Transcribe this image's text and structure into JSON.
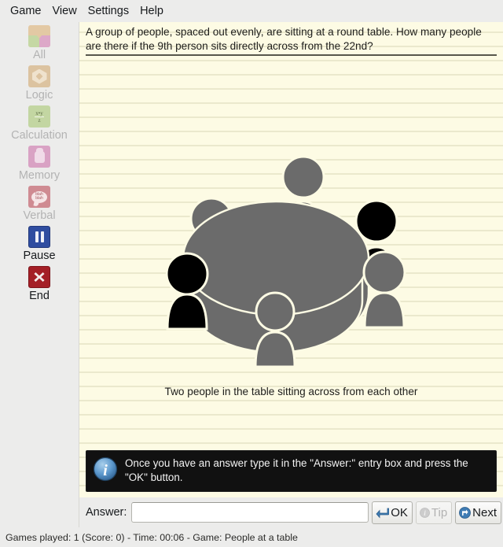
{
  "menubar": {
    "items": [
      {
        "label": "Game",
        "name": "menu-game"
      },
      {
        "label": "View",
        "name": "menu-view"
      },
      {
        "label": "Settings",
        "name": "menu-settings"
      },
      {
        "label": "Help",
        "name": "menu-help"
      }
    ]
  },
  "sidebar": {
    "items": [
      {
        "label": "All",
        "icon": "pie-chart-icon",
        "enabled": false
      },
      {
        "label": "Logic",
        "icon": "gem-icon",
        "enabled": false
      },
      {
        "label": "Calculation",
        "icon": "fraction-icon",
        "enabled": false
      },
      {
        "label": "Memory",
        "icon": "hand-icon",
        "enabled": false
      },
      {
        "label": "Verbal",
        "icon": "speech-bubble-icon",
        "enabled": false
      },
      {
        "label": "Pause",
        "icon": "pause-icon",
        "enabled": true
      },
      {
        "label": "End",
        "icon": "close-x-icon",
        "enabled": true
      }
    ],
    "calc_icon_numerator": "x•y",
    "calc_icon_denominator": "z",
    "verbal_icon_text": "blah blah"
  },
  "game": {
    "question": "A group of people, spaced out evenly, are sitting at a round table. How many people are there if the 9th person sits directly across from the 22nd?",
    "caption": "Two people in the table sitting across from each other",
    "figure": {
      "name": "people-at-round-table-illustration",
      "table_color": "#6b6b6b",
      "person_color": "#6b6b6b",
      "highlight_color": "#000000",
      "outline_color": "#fdfbe4",
      "people_total": 6,
      "people_highlighted": 2,
      "highlighted_positions": [
        "right-upper",
        "left-lower"
      ]
    }
  },
  "banner": {
    "icon": "info-icon",
    "text": "Once you have an answer type it in the \"Answer:\" entry box and press the \"OK\" button."
  },
  "answer": {
    "label": "Answer:",
    "value": "",
    "placeholder": ""
  },
  "buttons": {
    "ok": {
      "label": "OK",
      "icon": "enter-arrow-icon",
      "enabled": true
    },
    "tip": {
      "label": "Tip",
      "icon": "info-small-icon",
      "enabled": false
    },
    "next": {
      "label": "Next",
      "icon": "next-arrow-icon",
      "enabled": true
    }
  },
  "statusbar": {
    "text": "Games played: 1 (Score: 0) - Time: 00:06 - Game: People at a table",
    "games_played": 1,
    "score": 0,
    "time": "00:06",
    "game_name": "People at a table"
  },
  "colors": {
    "paper": "#fdfbe4",
    "rule_line": "#ebe9cd",
    "chrome": "#ececeb",
    "banner_bg": "#111111",
    "accent_blue": "#3a7cbe"
  }
}
